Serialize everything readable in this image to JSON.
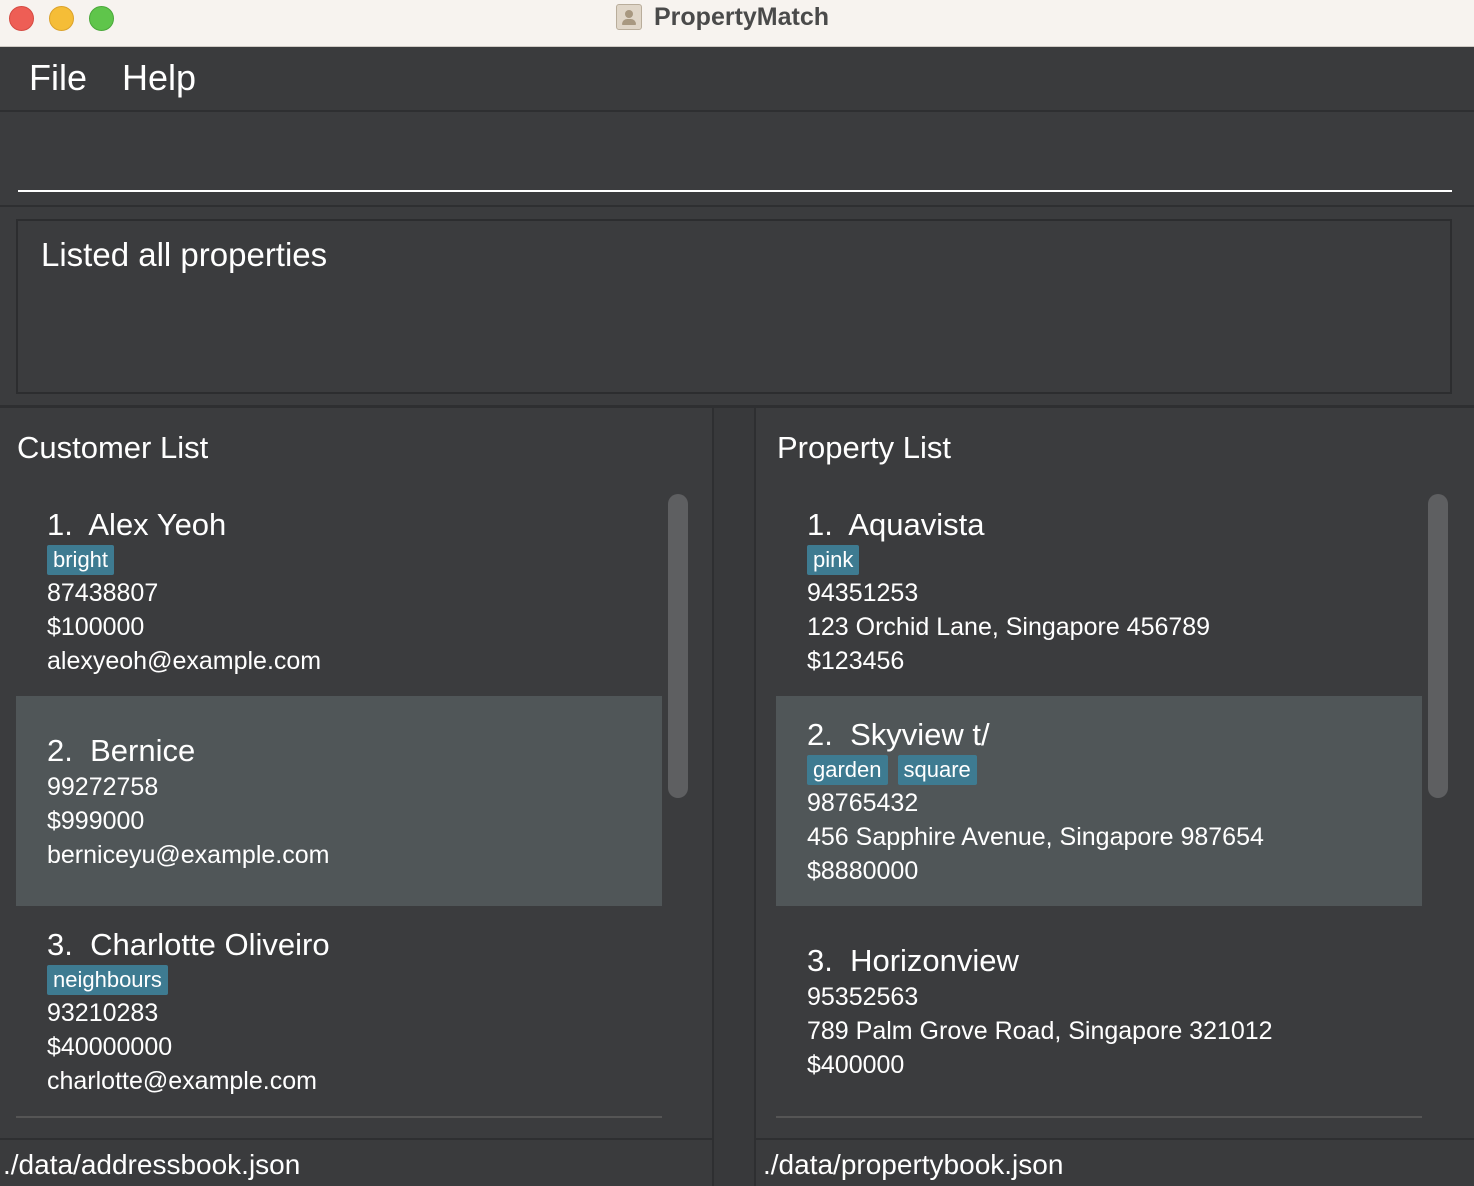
{
  "window": {
    "title": "PropertyMatch"
  },
  "menu": {
    "file": "File",
    "help": "Help"
  },
  "command": {
    "value": "",
    "placeholder": ""
  },
  "result": {
    "message": "Listed all properties"
  },
  "customers": {
    "title": "Customer List",
    "items": [
      {
        "index": "1.",
        "name": "Alex Yeoh",
        "tags": [
          "bright"
        ],
        "phone": "87438807",
        "budget": "$100000",
        "email": "alexyeoh@example.com"
      },
      {
        "index": "2.",
        "name": "Bernice",
        "tags": [],
        "phone": "99272758",
        "budget": "$999000",
        "email": "berniceyu@example.com"
      },
      {
        "index": "3.",
        "name": "Charlotte Oliveiro",
        "tags": [
          "neighbours"
        ],
        "phone": "93210283",
        "budget": "$40000000",
        "email": "charlotte@example.com"
      }
    ],
    "file_path": "./data/addressbook.json"
  },
  "properties": {
    "title": "Property List",
    "items": [
      {
        "index": "1.",
        "name": "Aquavista",
        "tags": [
          "pink"
        ],
        "phone": "94351253",
        "address": "123 Orchid Lane, Singapore 456789",
        "price": "$123456"
      },
      {
        "index": "2.",
        "name": "Skyview t/",
        "tags": [
          "garden",
          "square"
        ],
        "phone": "98765432",
        "address": "456 Sapphire Avenue, Singapore 987654",
        "price": "$8880000"
      },
      {
        "index": "3.",
        "name": "Horizonview",
        "tags": [],
        "phone": "95352563",
        "address": "789 Palm Grove Road, Singapore 321012",
        "price": "$400000"
      }
    ],
    "file_path": "./data/propertybook.json"
  },
  "colors": {
    "tag_bg": "#3e7b91",
    "selected_row": "#505658",
    "background": "#3b3c3e"
  }
}
